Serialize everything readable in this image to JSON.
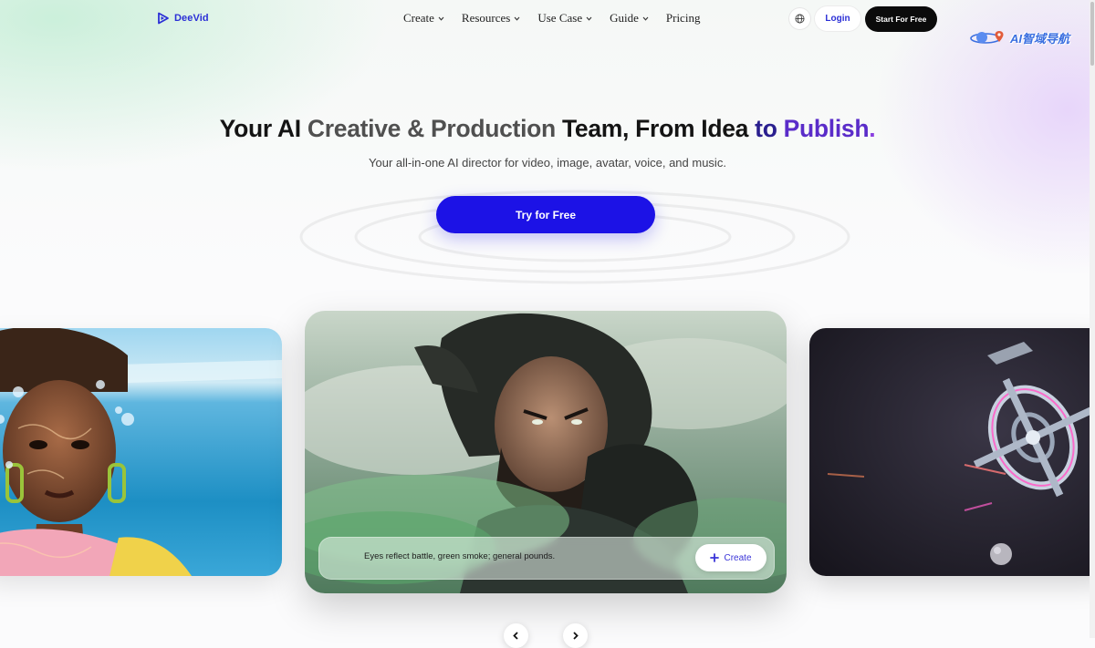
{
  "nav": {
    "brand": "DeeVid",
    "menu": [
      {
        "label": "Create",
        "dropdown": true
      },
      {
        "label": "Resources",
        "dropdown": true
      },
      {
        "label": "Use Case",
        "dropdown": true
      },
      {
        "label": "Guide",
        "dropdown": true
      },
      {
        "label": "Pricing",
        "dropdown": false
      }
    ],
    "login_label": "Login",
    "start_label": "Start For Free",
    "language_icon": "globe-icon"
  },
  "watermark": {
    "text": "AI智域导航"
  },
  "hero": {
    "headline_parts": [
      "Your AI ",
      "Creative & Production",
      " Team, From Idea ",
      "to ",
      "Publish",
      "."
    ],
    "subline": "Your all-in-one AI director for video, image, avatar, voice, and music.",
    "cta_label": "Try for Free"
  },
  "showcase": {
    "prompt_text": "Eyes reflect battle, green smoke; general pounds.",
    "create_label": "Create",
    "prev_icon": "chevron-left-icon",
    "next_icon": "chevron-right-icon"
  },
  "colors": {
    "brand_blue": "#1c12e6",
    "brand_text": "#2b2fd6",
    "accent_purple": "#5a2cc9",
    "dark_button": "#0b0b0b"
  }
}
